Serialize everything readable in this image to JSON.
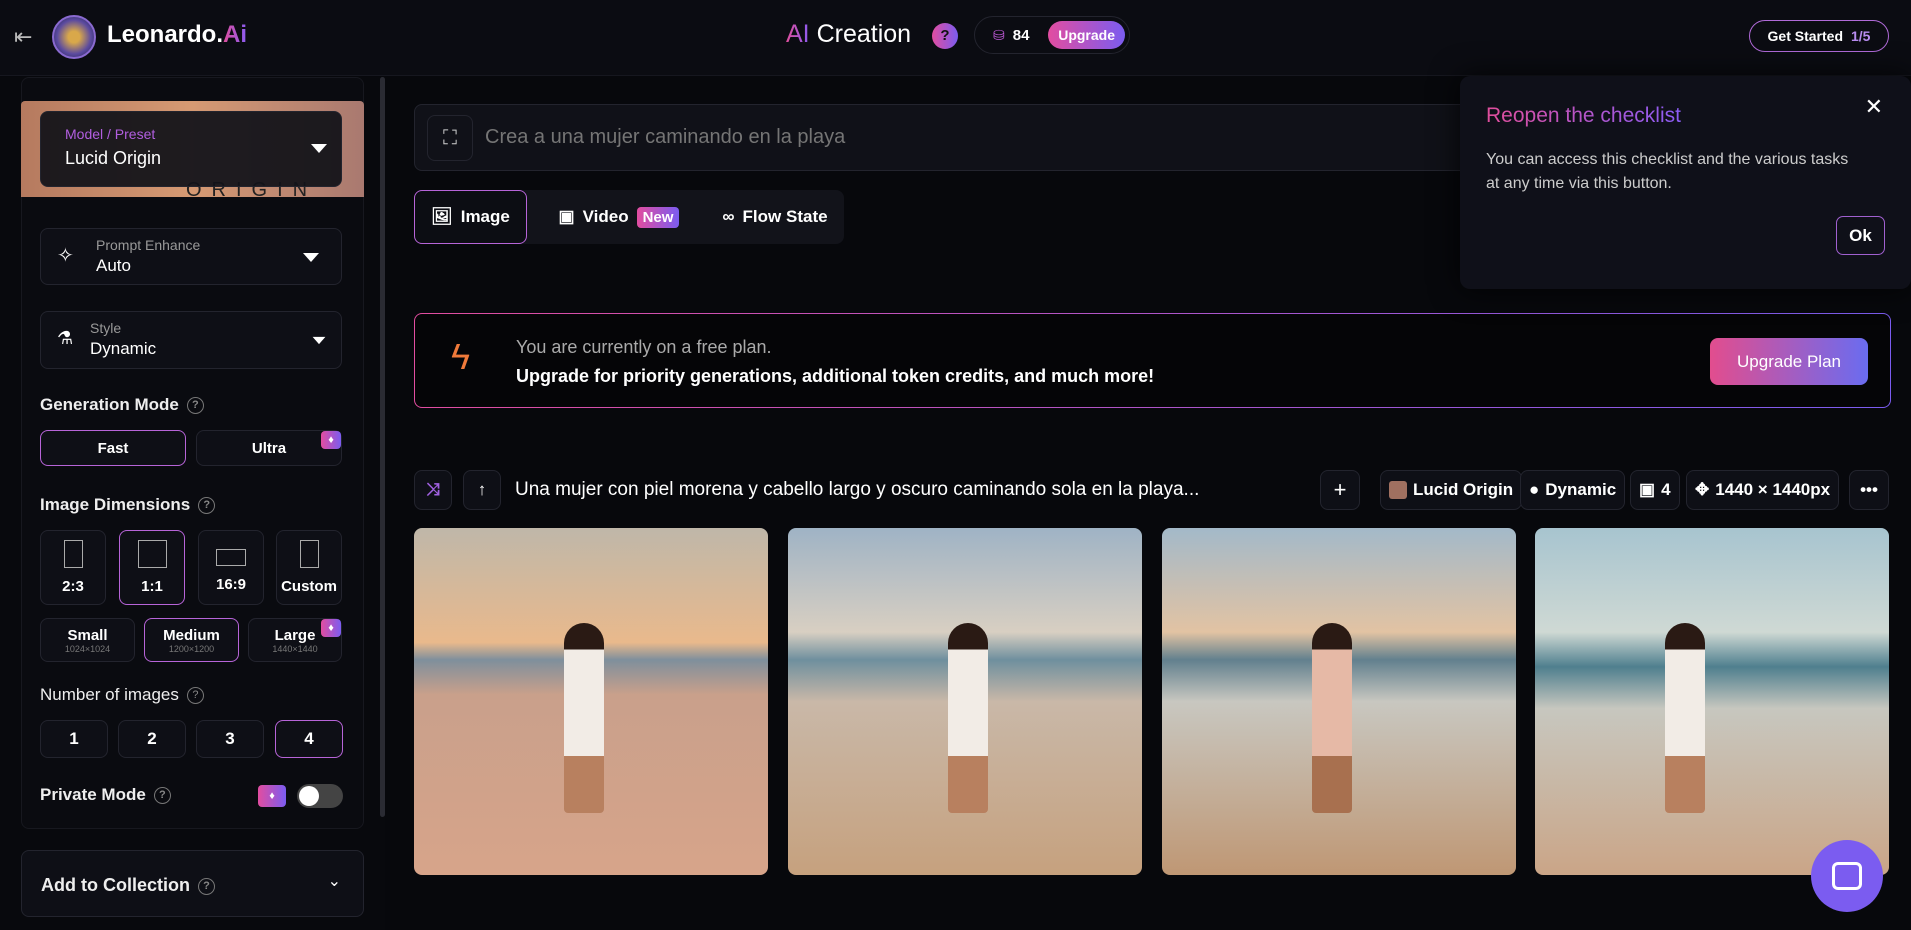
{
  "header": {
    "brand_main": "Leonardo.",
    "brand_accent": "Ai",
    "title_accent": "AI",
    "title_rest": " Creation",
    "help": "?",
    "tokens": "84",
    "upgrade": "Upgrade",
    "get_started": "Get Started",
    "progress": "1/5"
  },
  "sidebar": {
    "model": {
      "label": "Model / Preset",
      "value": "Lucid Origin",
      "banner": "ORIGIN"
    },
    "prompt_enhance": {
      "label": "Prompt Enhance",
      "value": "Auto"
    },
    "style": {
      "label": "Style",
      "value": "Dynamic"
    },
    "generation_mode": {
      "label": "Generation Mode",
      "options": [
        "Fast",
        "Ultra"
      ],
      "selected": "Fast"
    },
    "image_dimensions": {
      "label": "Image Dimensions",
      "ratios": [
        "2:3",
        "1:1",
        "16:9",
        "Custom"
      ],
      "selected_ratio": "1:1",
      "sizes": [
        {
          "name": "Small",
          "dims": "1024×1024"
        },
        {
          "name": "Medium",
          "dims": "1200×1200"
        },
        {
          "name": "Large",
          "dims": "1440×1440"
        }
      ],
      "selected_size": "Medium"
    },
    "number_of_images": {
      "label": "Number of images",
      "options": [
        "1",
        "2",
        "3",
        "4"
      ],
      "selected": "4"
    },
    "private_mode": {
      "label": "Private Mode",
      "on": false
    },
    "collection": {
      "label": "Add to Collection"
    }
  },
  "main": {
    "prompt_placeholder": "Crea a una mujer caminando en la playa",
    "tabs": [
      {
        "label": "Image"
      },
      {
        "label": "Video",
        "badge": "New"
      },
      {
        "label": "Flow State"
      }
    ],
    "banner": {
      "line1": "You are currently on a free plan.",
      "line2": "Upgrade for priority generations, additional token credits, and much more!",
      "button": "Upgrade Plan"
    },
    "generation": {
      "prompt": "Una mujer con piel morena y cabello largo y oscuro caminando sola en la playa...",
      "model": "Lucid Origin",
      "style": "Dynamic",
      "count": "4",
      "size": "1440 × 1440px"
    }
  },
  "popup": {
    "title": "Reopen the checklist",
    "body": "You can access this checklist and the various tasks at any time via this button.",
    "ok": "Ok"
  },
  "colors": {
    "accent_pink": "#e24da0",
    "accent_purple": "#7b5cf0",
    "background": "#07080c"
  }
}
